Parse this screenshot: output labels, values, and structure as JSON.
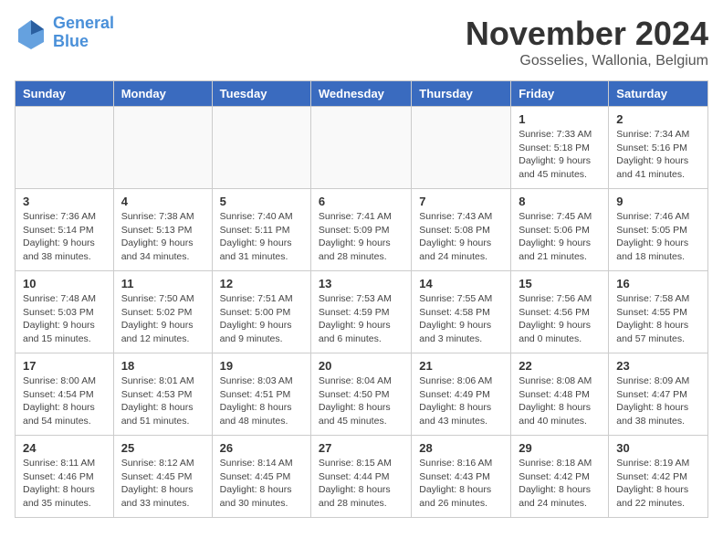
{
  "logo": {
    "text_general": "General",
    "text_blue": "Blue"
  },
  "title": "November 2024",
  "location": "Gosselies, Wallonia, Belgium",
  "days_of_week": [
    "Sunday",
    "Monday",
    "Tuesday",
    "Wednesday",
    "Thursday",
    "Friday",
    "Saturday"
  ],
  "weeks": [
    [
      {
        "day": "",
        "info": ""
      },
      {
        "day": "",
        "info": ""
      },
      {
        "day": "",
        "info": ""
      },
      {
        "day": "",
        "info": ""
      },
      {
        "day": "",
        "info": ""
      },
      {
        "day": "1",
        "info": "Sunrise: 7:33 AM\nSunset: 5:18 PM\nDaylight: 9 hours\nand 45 minutes."
      },
      {
        "day": "2",
        "info": "Sunrise: 7:34 AM\nSunset: 5:16 PM\nDaylight: 9 hours\nand 41 minutes."
      }
    ],
    [
      {
        "day": "3",
        "info": "Sunrise: 7:36 AM\nSunset: 5:14 PM\nDaylight: 9 hours\nand 38 minutes."
      },
      {
        "day": "4",
        "info": "Sunrise: 7:38 AM\nSunset: 5:13 PM\nDaylight: 9 hours\nand 34 minutes."
      },
      {
        "day": "5",
        "info": "Sunrise: 7:40 AM\nSunset: 5:11 PM\nDaylight: 9 hours\nand 31 minutes."
      },
      {
        "day": "6",
        "info": "Sunrise: 7:41 AM\nSunset: 5:09 PM\nDaylight: 9 hours\nand 28 minutes."
      },
      {
        "day": "7",
        "info": "Sunrise: 7:43 AM\nSunset: 5:08 PM\nDaylight: 9 hours\nand 24 minutes."
      },
      {
        "day": "8",
        "info": "Sunrise: 7:45 AM\nSunset: 5:06 PM\nDaylight: 9 hours\nand 21 minutes."
      },
      {
        "day": "9",
        "info": "Sunrise: 7:46 AM\nSunset: 5:05 PM\nDaylight: 9 hours\nand 18 minutes."
      }
    ],
    [
      {
        "day": "10",
        "info": "Sunrise: 7:48 AM\nSunset: 5:03 PM\nDaylight: 9 hours\nand 15 minutes."
      },
      {
        "day": "11",
        "info": "Sunrise: 7:50 AM\nSunset: 5:02 PM\nDaylight: 9 hours\nand 12 minutes."
      },
      {
        "day": "12",
        "info": "Sunrise: 7:51 AM\nSunset: 5:00 PM\nDaylight: 9 hours\nand 9 minutes."
      },
      {
        "day": "13",
        "info": "Sunrise: 7:53 AM\nSunset: 4:59 PM\nDaylight: 9 hours\nand 6 minutes."
      },
      {
        "day": "14",
        "info": "Sunrise: 7:55 AM\nSunset: 4:58 PM\nDaylight: 9 hours\nand 3 minutes."
      },
      {
        "day": "15",
        "info": "Sunrise: 7:56 AM\nSunset: 4:56 PM\nDaylight: 9 hours\nand 0 minutes."
      },
      {
        "day": "16",
        "info": "Sunrise: 7:58 AM\nSunset: 4:55 PM\nDaylight: 8 hours\nand 57 minutes."
      }
    ],
    [
      {
        "day": "17",
        "info": "Sunrise: 8:00 AM\nSunset: 4:54 PM\nDaylight: 8 hours\nand 54 minutes."
      },
      {
        "day": "18",
        "info": "Sunrise: 8:01 AM\nSunset: 4:53 PM\nDaylight: 8 hours\nand 51 minutes."
      },
      {
        "day": "19",
        "info": "Sunrise: 8:03 AM\nSunset: 4:51 PM\nDaylight: 8 hours\nand 48 minutes."
      },
      {
        "day": "20",
        "info": "Sunrise: 8:04 AM\nSunset: 4:50 PM\nDaylight: 8 hours\nand 45 minutes."
      },
      {
        "day": "21",
        "info": "Sunrise: 8:06 AM\nSunset: 4:49 PM\nDaylight: 8 hours\nand 43 minutes."
      },
      {
        "day": "22",
        "info": "Sunrise: 8:08 AM\nSunset: 4:48 PM\nDaylight: 8 hours\nand 40 minutes."
      },
      {
        "day": "23",
        "info": "Sunrise: 8:09 AM\nSunset: 4:47 PM\nDaylight: 8 hours\nand 38 minutes."
      }
    ],
    [
      {
        "day": "24",
        "info": "Sunrise: 8:11 AM\nSunset: 4:46 PM\nDaylight: 8 hours\nand 35 minutes."
      },
      {
        "day": "25",
        "info": "Sunrise: 8:12 AM\nSunset: 4:45 PM\nDaylight: 8 hours\nand 33 minutes."
      },
      {
        "day": "26",
        "info": "Sunrise: 8:14 AM\nSunset: 4:45 PM\nDaylight: 8 hours\nand 30 minutes."
      },
      {
        "day": "27",
        "info": "Sunrise: 8:15 AM\nSunset: 4:44 PM\nDaylight: 8 hours\nand 28 minutes."
      },
      {
        "day": "28",
        "info": "Sunrise: 8:16 AM\nSunset: 4:43 PM\nDaylight: 8 hours\nand 26 minutes."
      },
      {
        "day": "29",
        "info": "Sunrise: 8:18 AM\nSunset: 4:42 PM\nDaylight: 8 hours\nand 24 minutes."
      },
      {
        "day": "30",
        "info": "Sunrise: 8:19 AM\nSunset: 4:42 PM\nDaylight: 8 hours\nand 22 minutes."
      }
    ]
  ]
}
